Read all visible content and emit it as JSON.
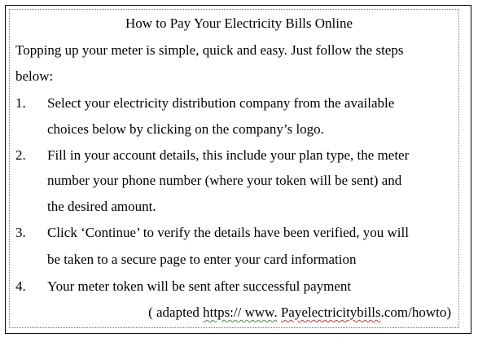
{
  "document": {
    "title": "How to Pay Your Electricity Bills Online",
    "intro": {
      "line1": "Topping up your meter is simple, quick and easy.  Just follow the steps",
      "line2": "below:"
    },
    "steps": [
      {
        "number": "1.",
        "lines": [
          "Select your electricity  distribution company from the available",
          "choices below by clicking on the company’s logo."
        ]
      },
      {
        "number": "2.",
        "lines": [
          "Fill in your account details, this include your plan type, the meter",
          "number your phone number (where your token will be sent) and",
          "the desired amount."
        ]
      },
      {
        "number": "3.",
        "lines": [
          "Click ‘Continue’ to verify the details have been verified, you will",
          "be taken to a secure page to enter your card information"
        ]
      },
      {
        "number": "4.",
        "lines": [
          "Your meter token will be sent after successful payment"
        ]
      }
    ],
    "source": {
      "prefix": "( adapted",
      "url_part1": "https:// www.",
      "url_part2": "Payelectricitybills",
      "url_part3": ".com/howto)"
    }
  }
}
